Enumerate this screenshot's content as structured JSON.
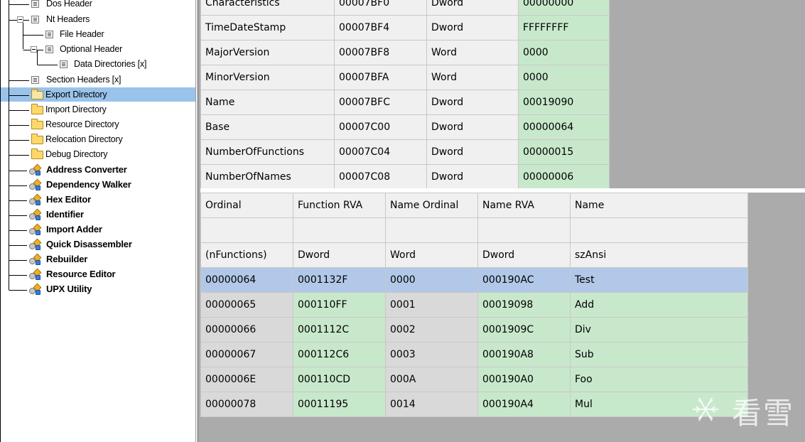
{
  "tree": {
    "items": [
      {
        "label": "Dos Header",
        "icon": "doc-icon"
      },
      {
        "label": "Nt Headers",
        "icon": "doc-icon"
      },
      {
        "label": "File Header",
        "icon": "doc-icon"
      },
      {
        "label": "Optional Header",
        "icon": "doc-icon"
      },
      {
        "label": "Data Directories [x]",
        "icon": "doc-icon"
      },
      {
        "label": "Section Headers [x]",
        "icon": "doc-icon"
      },
      {
        "label": "Export Directory",
        "icon": "folder-icon"
      },
      {
        "label": "Import Directory",
        "icon": "folder-icon"
      },
      {
        "label": "Resource Directory",
        "icon": "folder-icon"
      },
      {
        "label": "Relocation Directory",
        "icon": "folder-icon"
      },
      {
        "label": "Debug Directory",
        "icon": "folder-icon"
      },
      {
        "label": "Address Converter",
        "icon": "tool-icon"
      },
      {
        "label": "Dependency Walker",
        "icon": "tool-icon"
      },
      {
        "label": "Hex Editor",
        "icon": "tool-icon"
      },
      {
        "label": "Identifier",
        "icon": "tool-icon"
      },
      {
        "label": "Import Adder",
        "icon": "tool-icon"
      },
      {
        "label": "Quick Disassembler",
        "icon": "tool-icon"
      },
      {
        "label": "Rebuilder",
        "icon": "tool-icon"
      },
      {
        "label": "Resource Editor",
        "icon": "tool-icon"
      },
      {
        "label": "UPX Utility",
        "icon": "tool-icon"
      }
    ],
    "selected": "Export Directory"
  },
  "export_fields": [
    {
      "member": "Characteristics",
      "offset": "00007BF0",
      "size": "Dword",
      "value": "00000000"
    },
    {
      "member": "TimeDateStamp",
      "offset": "00007BF4",
      "size": "Dword",
      "value": "FFFFFFFF"
    },
    {
      "member": "MajorVersion",
      "offset": "00007BF8",
      "size": "Word",
      "value": "0000"
    },
    {
      "member": "MinorVersion",
      "offset": "00007BFA",
      "size": "Word",
      "value": "0000"
    },
    {
      "member": "Name",
      "offset": "00007BFC",
      "size": "Dword",
      "value": "00019090"
    },
    {
      "member": "Base",
      "offset": "00007C00",
      "size": "Dword",
      "value": "00000064"
    },
    {
      "member": "NumberOfFunctions",
      "offset": "00007C04",
      "size": "Dword",
      "value": "00000015"
    },
    {
      "member": "NumberOfNames",
      "offset": "00007C08",
      "size": "Dword",
      "value": "00000006"
    }
  ],
  "functions": {
    "headers": [
      "Ordinal",
      "Function RVA",
      "Name Ordinal",
      "Name RVA",
      "Name"
    ],
    "blank_row": [
      "",
      "",
      "",
      "",
      ""
    ],
    "type_row": [
      "(nFunctions)",
      "Dword",
      "Word",
      "Dword",
      "szAnsi"
    ],
    "rows": [
      [
        "00000064",
        "0001132F",
        "0000",
        "000190AC",
        "Test"
      ],
      [
        "00000065",
        "000110FF",
        "0001",
        "00019098",
        "Add"
      ],
      [
        "00000066",
        "0001112C",
        "0002",
        "0001909C",
        "Div"
      ],
      [
        "00000067",
        "000112C6",
        "0003",
        "000190A8",
        "Sub"
      ],
      [
        "0000006E",
        "000110CD",
        "000A",
        "000190A0",
        "Foo"
      ],
      [
        "00000078",
        "00011195",
        "0014",
        "000190A4",
        "Mul"
      ]
    ],
    "selected_row": 0
  },
  "watermark": {
    "text": "看雪",
    "icon": "snowflake-icon"
  },
  "colors": {
    "selection": "#99c3ea",
    "value_green": "#c8e8cc",
    "row_selected": "#b2c8e8"
  }
}
